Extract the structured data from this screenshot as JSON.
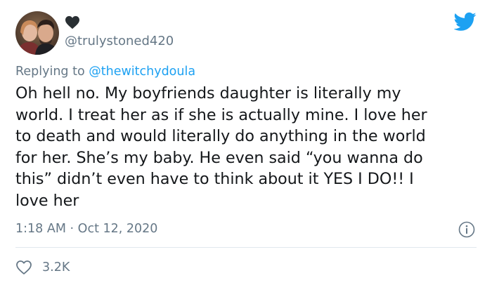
{
  "tweet": {
    "author": {
      "handle": "@trulystoned420",
      "name_emoji": "black-heart-icon",
      "avatar": "profile-photo-couple"
    },
    "replying_prefix": "Replying to",
    "replying_to": "@thewitchydoula",
    "text": "Oh hell no. My boyfriends daughter is literally my\nworld. I treat her as if she is actually mine. I love her\nto death and would literally do anything in the world\nfor her. She’s my baby. He even said “you wanna do\nthis” didn’t even have to think about it YES I DO!! I\nlove her",
    "time": "1:18 AM",
    "separator": "·",
    "date": "Oct 12, 2020",
    "likes": "3.2K"
  },
  "icons": {
    "brand": "twitter-bird-icon",
    "info": "info-icon",
    "like": "heart-outline-icon"
  },
  "colors": {
    "brand_blue": "#1da1f2",
    "secondary_text": "#657786",
    "primary_text": "#14171a",
    "divider": "#e1e8ed"
  }
}
